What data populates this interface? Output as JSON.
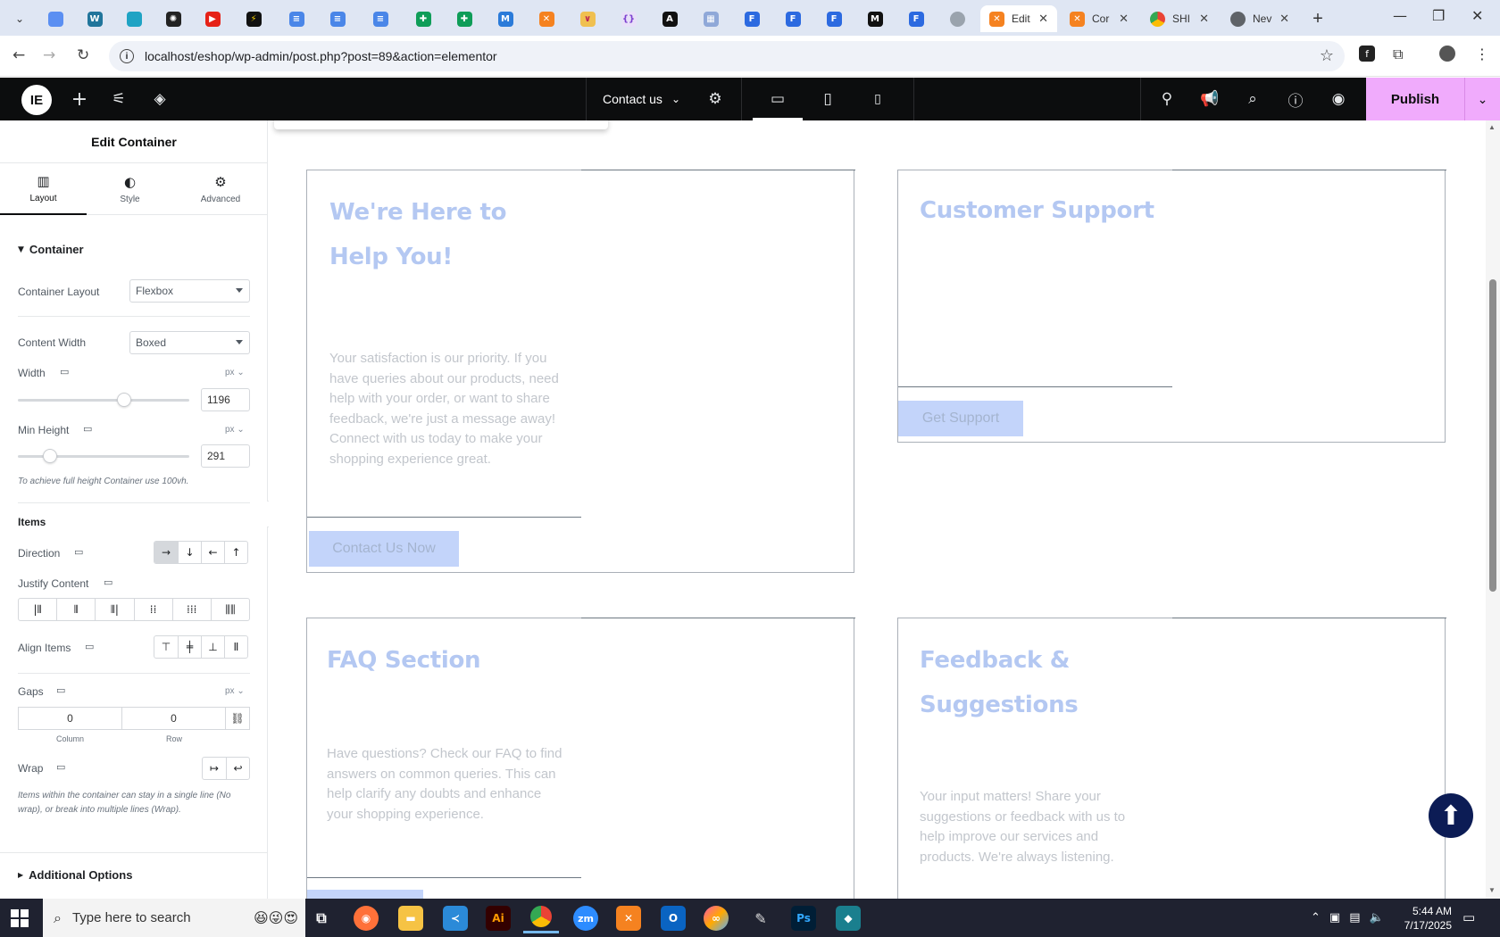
{
  "browser": {
    "tabs": [
      {
        "label": "Edit",
        "active": true
      },
      {
        "label": "Cor",
        "active": false
      },
      {
        "label": "SHI",
        "active": false
      },
      {
        "label": "Nev",
        "active": false
      }
    ],
    "url": "localhost/eshop/wp-admin/post.php?post=89&action=elementor",
    "tab_close": "✕",
    "new_tab": "+",
    "window_controls": {
      "minimize": "—",
      "restore": "❐",
      "close": "✕"
    }
  },
  "elementor": {
    "page_name": "Contact us",
    "publish_label": "Publish",
    "panel": {
      "title": "Edit Container",
      "tabs": [
        {
          "label": "Layout",
          "icon": "layout-icon"
        },
        {
          "label": "Style",
          "icon": "contrast-icon"
        },
        {
          "label": "Advanced",
          "icon": "gear-icon"
        }
      ],
      "section_title": "Container",
      "container_layout": {
        "label": "Container Layout",
        "value": "Flexbox"
      },
      "content_width": {
        "label": "Content Width",
        "value": "Boxed"
      },
      "width": {
        "label": "Width",
        "unit": "px",
        "value": "1196",
        "slider_fraction": 0.62
      },
      "min_height": {
        "label": "Min Height",
        "unit": "px",
        "value": "291",
        "slider_fraction": 0.19
      },
      "min_height_hint": "To achieve full height Container use 100vh.",
      "items_title": "Items",
      "direction_label": "Direction",
      "justify_label": "Justify Content",
      "align_label": "Align Items",
      "gaps": {
        "label": "Gaps",
        "unit": "px",
        "column": "0",
        "row": "0",
        "column_label": "Column",
        "row_label": "Row"
      },
      "wrap_label": "Wrap",
      "wrap_hint": "Items within the container can stay in a single line (No wrap), or break into multiple lines (Wrap).",
      "additional_options": "Additional Options"
    }
  },
  "content": {
    "cards": [
      {
        "title": "We're Here to Help You!",
        "text": "Your satisfaction is our priority. If you have queries about our products, need help with your order, or want to share feedback, we're just a message away! Connect with us today to make your shopping experience great.",
        "button": "Contact Us Now"
      },
      {
        "title": "Customer Support",
        "text": "",
        "button": "Get Support"
      },
      {
        "title": "FAQ Section",
        "text": "Have questions? Check our FAQ to find answers on common queries. This can help clarify any doubts and enhance your shopping experience.",
        "button": ""
      },
      {
        "title": "Feedback & Suggestions",
        "text": "Your input matters! Share your suggestions or feedback with us to help improve our services and products. We're always listening.",
        "button": ""
      }
    ]
  },
  "taskbar": {
    "search_placeholder": "Type here to search",
    "time": "5:44 AM",
    "date": "7/17/2025"
  },
  "colors": {
    "heading": "#b4c8f2",
    "button_bg": "#c3d4fa",
    "publish_bg": "#f0abfc",
    "topbar_bg": "#0c0d0e",
    "scroll_top_bg": "#0c1c55"
  }
}
